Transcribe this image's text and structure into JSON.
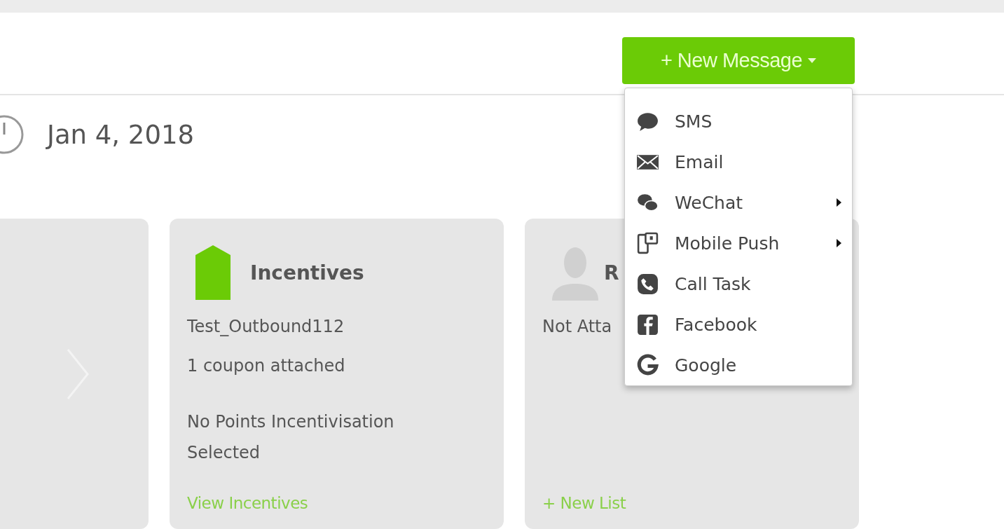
{
  "header": {
    "new_message_button": "+ New Message"
  },
  "menu": [
    {
      "label": "SMS",
      "submenu": false
    },
    {
      "label": "Email",
      "submenu": false
    },
    {
      "label": "WeChat",
      "submenu": true
    },
    {
      "label": "Mobile Push",
      "submenu": true
    },
    {
      "label": "Call Task",
      "submenu": false
    },
    {
      "label": "Facebook",
      "submenu": false
    },
    {
      "label": "Google",
      "submenu": false
    }
  ],
  "date": "Jan 4, 2018",
  "cards": [
    {
      "kind": "nav"
    },
    {
      "kind": "incentives",
      "title": "Incentives",
      "lines": [
        "Test_Outbound112",
        "1 coupon attached"
      ],
      "note": "No Points Incentivisation Selected",
      "link": "View Incentives"
    },
    {
      "kind": "recipients",
      "title": "R",
      "lines": [
        "Not Atta"
      ],
      "link": "+ New List"
    }
  ]
}
